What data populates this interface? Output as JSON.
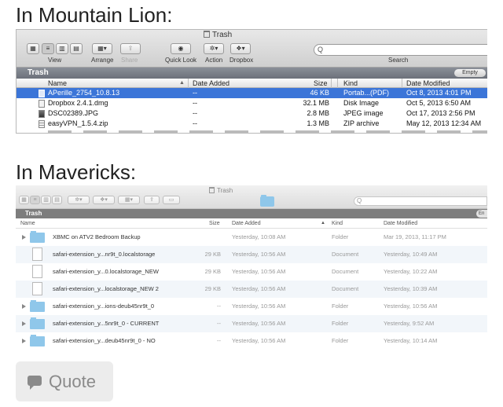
{
  "headings": {
    "mountain_lion": "In Mountain Lion:",
    "mavericks": "In Mavericks:"
  },
  "mountain_lion": {
    "title": "Trash",
    "toolbar": {
      "labels": {
        "view": "View",
        "arrange": "Arrange",
        "share": "Share",
        "quick_look": "Quick Look",
        "action": "Action",
        "dropbox": "Dropbox",
        "search": "Search"
      },
      "search_placeholder": "Q"
    },
    "path": "Trash",
    "empty_button": "Empty",
    "columns": {
      "name": "Name",
      "date_added": "Date Added",
      "size": "Size",
      "kind": "Kind",
      "date_modified": "Date Modified"
    },
    "rows": [
      {
        "name": "APerille_2754_10.8.13",
        "date_added": "--",
        "size": "46 KB",
        "kind": "Portab...(PDF)",
        "date_modified": "Oct 8, 2013 4:01 PM",
        "icon": "pdf-icon",
        "selected": true
      },
      {
        "name": "Dropbox 2.4.1.dmg",
        "date_added": "--",
        "size": "32.1 MB",
        "kind": "Disk Image",
        "date_modified": "Oct 5, 2013 6:50 AM",
        "icon": "dmg-icon",
        "selected": false
      },
      {
        "name": "DSC02389.JPG",
        "date_added": "--",
        "size": "2.8 MB",
        "kind": "JPEG image",
        "date_modified": "Oct 17, 2013 2:56 PM",
        "icon": "jpeg-icon",
        "selected": false
      },
      {
        "name": "easyVPN_1.5.4.zip",
        "date_added": "--",
        "size": "1.3 MB",
        "kind": "ZIP archive",
        "date_modified": "May 12, 2013 12:34 AM",
        "icon": "zip-icon",
        "selected": false
      }
    ]
  },
  "mavericks": {
    "title": "Trash",
    "path": "Trash",
    "empty_button": "En",
    "search_placeholder": "Q",
    "columns": {
      "name": "Name",
      "size": "Size",
      "date_added": "Date Added",
      "kind": "Kind",
      "date_modified": "Date Modified"
    },
    "rows": [
      {
        "name": "XBMC on ATV2 Bedroom Backup",
        "size": "",
        "date_added": "Yesterday, 10:08 AM",
        "kind": "Folder",
        "date_modified": "Mar 19, 2013, 11:17 PM",
        "icon": "folder-icon"
      },
      {
        "name": "safari-extension_y...nr9t_0.localstorage",
        "size": "29 KB",
        "date_added": "Yesterday, 10:56 AM",
        "kind": "Document",
        "date_modified": "Yesterday, 10:49 AM",
        "icon": "document-icon"
      },
      {
        "name": "safari-extension_y...0.localstorage_NEW",
        "size": "29 KB",
        "date_added": "Yesterday, 10:56 AM",
        "kind": "Document",
        "date_modified": "Yesterday, 10:22 AM",
        "icon": "document-icon"
      },
      {
        "name": "safari-extension_y...localstorage_NEW 2",
        "size": "29 KB",
        "date_added": "Yesterday, 10:56 AM",
        "kind": "Document",
        "date_modified": "Yesterday, 10:39 AM",
        "icon": "document-icon"
      },
      {
        "name": "safari-extension_y...ions-deub45nr9t_0",
        "size": "--",
        "date_added": "Yesterday, 10:56 AM",
        "kind": "Folder",
        "date_modified": "Yesterday, 10:56 AM",
        "icon": "folder-icon"
      },
      {
        "name": "safari-extension_y...5nr9t_0 - CURRENT",
        "size": "--",
        "date_added": "Yesterday, 10:56 AM",
        "kind": "Folder",
        "date_modified": "Yesterday, 9:52 AM",
        "icon": "folder-icon"
      },
      {
        "name": "safari-extension_y...deub45nr9t_0 - NO",
        "size": "--",
        "date_added": "Yesterday, 10:56 AM",
        "kind": "Folder",
        "date_modified": "Yesterday, 10:14 AM",
        "icon": "folder-icon"
      }
    ]
  },
  "quote_button": {
    "label": "Quote",
    "icon": "speech-bubble-icon"
  }
}
